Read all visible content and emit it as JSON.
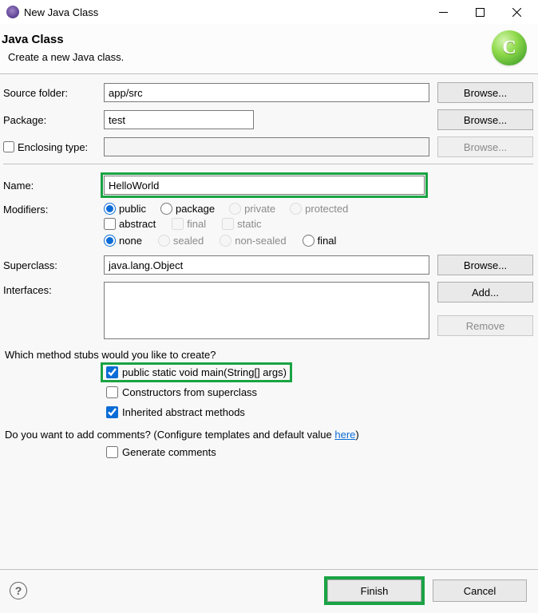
{
  "window": {
    "title": "New Java Class"
  },
  "banner": {
    "heading": "Java Class",
    "subtitle": "Create a new Java class.",
    "icon_letter": "C"
  },
  "labels": {
    "source_folder": "Source folder:",
    "package": "Package:",
    "enclosing_type": "Enclosing type:",
    "name": "Name:",
    "modifiers": "Modifiers:",
    "superclass": "Superclass:",
    "interfaces": "Interfaces:",
    "method_stubs_q": "Which method stubs would you like to create?",
    "comments_q_pre": "Do you want to add comments? (Configure templates and default value ",
    "comments_q_link": "here",
    "comments_q_post": ")"
  },
  "values": {
    "source_folder": "app/src",
    "package": "test",
    "enclosing_type": "",
    "name": "HelloWorld",
    "superclass": "java.lang.Object"
  },
  "modifiers": {
    "access": {
      "public": "public",
      "package": "package",
      "private": "private",
      "protected": "protected",
      "selected": "public"
    },
    "flags": {
      "abstract": "abstract",
      "final": "final",
      "static": "static"
    },
    "sealing": {
      "none": "none",
      "sealed": "sealed",
      "non_sealed": "non-sealed",
      "final": "final",
      "selected": "none"
    }
  },
  "buttons": {
    "browse": "Browse...",
    "add": "Add...",
    "remove": "Remove",
    "finish": "Finish",
    "cancel": "Cancel"
  },
  "stubs": {
    "main": "public static void main(String[] args)",
    "constructors": "Constructors from superclass",
    "inherited": "Inherited abstract methods"
  },
  "comments": {
    "generate": "Generate comments"
  }
}
